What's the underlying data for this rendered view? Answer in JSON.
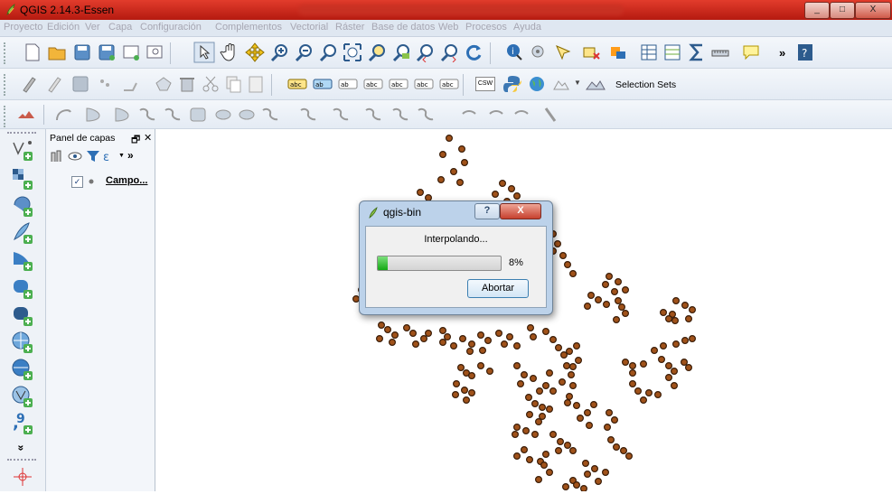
{
  "window": {
    "title": "QGIS 2.14.3-Essen",
    "controls": {
      "minimize": "_",
      "maximize": "□",
      "close": "X"
    }
  },
  "menu": [
    "Proyecto",
    "Edición",
    "Ver",
    "Capa",
    "Configuración",
    "Complementos",
    "Vectorial",
    "Ráster",
    "Base de datos",
    "Web",
    "Procesos",
    "Ayuda"
  ],
  "toolbar3": {
    "selection_sets_label": "Selection Sets",
    "csw_label": "CSW"
  },
  "layers_panel": {
    "title": "Panel de capas",
    "undock_glyph": "🗗",
    "close_glyph": "✕",
    "more_glyph": "»",
    "layers": [
      {
        "name": "Campo...",
        "checked": true
      }
    ]
  },
  "left_toolbar": {
    "more_glyph": "»"
  },
  "dialog": {
    "title": "qgis-bin",
    "message": "Interpolando...",
    "progress_percent": 8,
    "progress_label": "8%",
    "abort_label": "Abortar",
    "help_glyph": "?",
    "close_glyph": "X"
  },
  "colors": {
    "point_fill": "#a0521a",
    "point_stroke": "#3a1d08",
    "progress": "#1aad1a"
  }
}
